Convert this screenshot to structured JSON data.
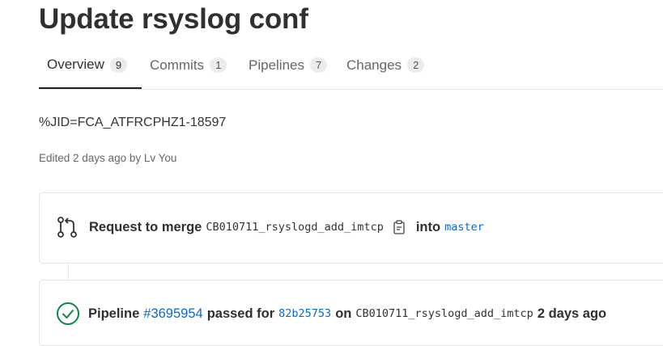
{
  "title": "Update rsyslog conf",
  "tabs": [
    {
      "label": "Overview",
      "count": "9"
    },
    {
      "label": "Commits",
      "count": "1"
    },
    {
      "label": "Pipelines",
      "count": "7"
    },
    {
      "label": "Changes",
      "count": "2"
    }
  ],
  "description": "%JID=FCA_ATFRCPHZ1-18597",
  "edited": "Edited 2 days ago by Lv You",
  "merge": {
    "prefix": "Request to merge",
    "source_branch": "CB010711_rsyslogd_add_imtcp",
    "into": "into",
    "target_branch": "master"
  },
  "pipeline": {
    "label": "Pipeline",
    "id": "#3695954",
    "status_text": "passed for",
    "commit": "82b25753",
    "on": "on",
    "branch": "CB010711_rsyslogd_add_imtcp",
    "time": "2 days ago"
  },
  "colors": {
    "link": "#1068bf",
    "success": "#108548"
  }
}
